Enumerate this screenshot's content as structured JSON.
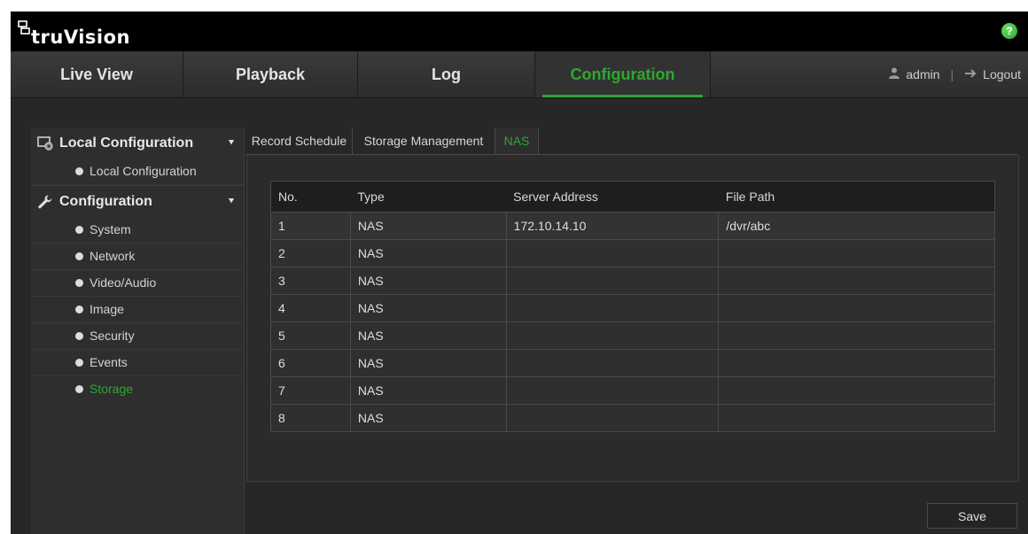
{
  "header": {
    "logo_text": "truVision",
    "help_label": "?"
  },
  "nav": {
    "tabs": [
      {
        "label": "Live View"
      },
      {
        "label": "Playback"
      },
      {
        "label": "Log"
      },
      {
        "label": "Configuration",
        "active": true
      }
    ],
    "user": "admin",
    "separator": "|",
    "logout_label": "Logout"
  },
  "sidebar": {
    "sections": [
      {
        "title": "Local Configuration",
        "items": [
          "Local Configuration"
        ]
      },
      {
        "title": "Configuration",
        "items": [
          "System",
          "Network",
          "Video/Audio",
          "Image",
          "Security",
          "Events",
          "Storage"
        ]
      }
    ],
    "active_item": "Storage"
  },
  "subtabs": [
    "Record Schedule",
    "Storage Management",
    "NAS"
  ],
  "active_subtab": "NAS",
  "table": {
    "headers": [
      "No.",
      "Type",
      "Server Address",
      "File Path"
    ],
    "rows": [
      [
        "1",
        "NAS",
        "172.10.14.10",
        "/dvr/abc"
      ],
      [
        "2",
        "NAS",
        "",
        ""
      ],
      [
        "3",
        "NAS",
        "",
        ""
      ],
      [
        "4",
        "NAS",
        "",
        ""
      ],
      [
        "5",
        "NAS",
        "",
        ""
      ],
      [
        "6",
        "NAS",
        "",
        ""
      ],
      [
        "7",
        "NAS",
        "",
        ""
      ],
      [
        "8",
        "NAS",
        "",
        ""
      ]
    ]
  },
  "save_label": "Save",
  "colors": {
    "accent": "#2ea82e",
    "background": "#272727",
    "header": "#000000"
  }
}
